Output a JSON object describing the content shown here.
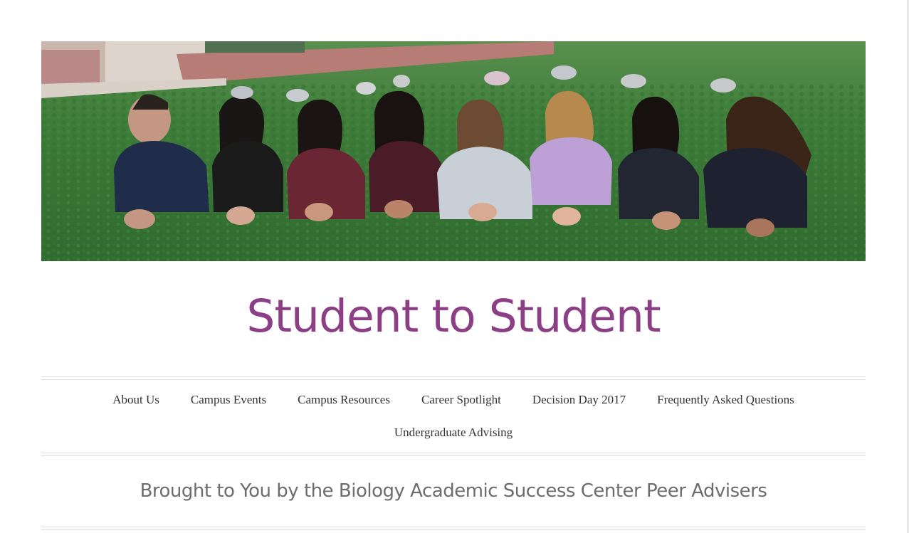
{
  "header": {
    "image_alt": "Group of students lying on the grass"
  },
  "site": {
    "title": "Student to Student",
    "tagline": "Brought to You by the Biology Academic Success Center Peer Advisers",
    "title_color": "#8d3f86"
  },
  "nav": {
    "items": [
      {
        "label": "About Us"
      },
      {
        "label": "Campus Events"
      },
      {
        "label": "Campus Resources"
      },
      {
        "label": "Career Spotlight"
      },
      {
        "label": "Decision Day 2017"
      },
      {
        "label": "Frequently Asked Questions"
      },
      {
        "label": "Undergraduate Advising"
      }
    ]
  }
}
